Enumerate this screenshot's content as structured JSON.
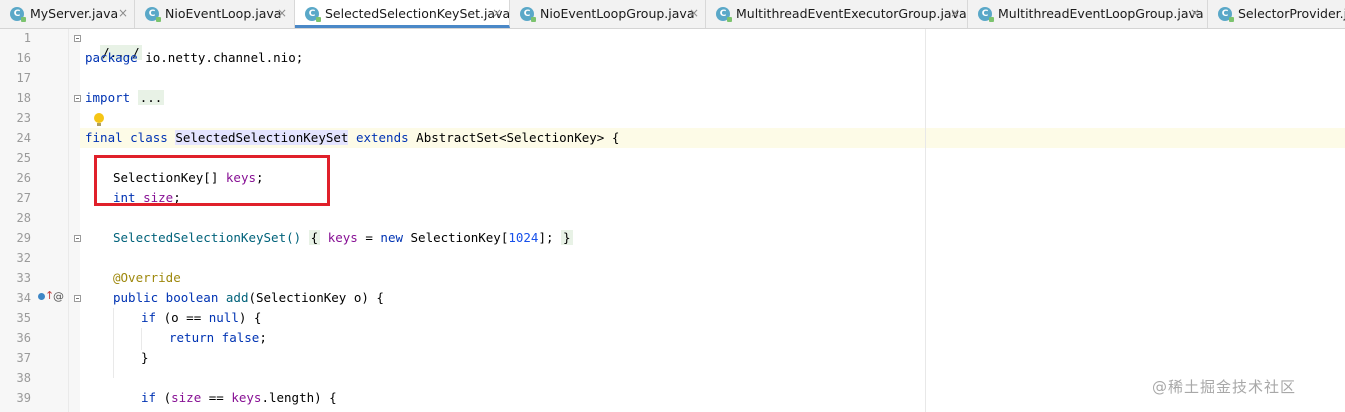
{
  "tabs": [
    {
      "label": "MyServer.java",
      "icon": "C",
      "active": false
    },
    {
      "label": "NioEventLoop.java",
      "icon": "C",
      "active": false
    },
    {
      "label": "SelectedSelectionKeySet.java",
      "icon": "C",
      "active": true
    },
    {
      "label": "NioEventLoopGroup.java",
      "icon": "C",
      "active": false
    },
    {
      "label": "MultithreadEventExecutorGroup.java",
      "icon": "C",
      "active": false
    },
    {
      "label": "MultithreadEventLoopGroup.java",
      "icon": "C",
      "active": false
    },
    {
      "label": "SelectorProvider.java",
      "icon": "C",
      "active": false
    }
  ],
  "tab_close_glyph": "×",
  "gutter": {
    "line_numbers": [
      "1",
      "16",
      "17",
      "18",
      "23",
      "24",
      "25",
      "26",
      "27",
      "28",
      "29",
      "32",
      "33",
      "34",
      "35",
      "36",
      "37",
      "38",
      "39"
    ]
  },
  "code": {
    "l1": "/.../",
    "l16_kw": "package",
    "l16_rest": " io.netty.channel.nio;",
    "l18_kw": "import",
    "l18_fold": "...",
    "l24_kw1": "final class",
    "l24_name": "SelectedSelectionKeySet",
    "l24_kw2": "extends",
    "l24_rest": " AbstractSet<SelectionKey> {",
    "l26_type": "SelectionKey[] ",
    "l26_field": "keys",
    "l26_end": ";",
    "l27_kw": "int",
    "l27_field": "size",
    "l27_end": ";",
    "l29_ctor": "SelectedSelectionKeySet() ",
    "l29_open": "{",
    "l29_field": "keys",
    "l29_eq": " = ",
    "l29_new": "new",
    "l29_type": " SelectionKey[",
    "l29_num": "1024",
    "l29_end": "]; ",
    "l29_close": "}",
    "l33_ann": "@Override",
    "l34_kw": "public boolean",
    "l34_method": "add",
    "l34_rest": "(SelectionKey o) {",
    "l35_kw": "if",
    "l35_rest": " (o == ",
    "l35_null": "null",
    "l35_end": ") {",
    "l36_kw": "return false",
    "l36_end": ";",
    "l37": "}",
    "l39_kw": "if",
    "l39_open": " (",
    "l39_f1": "size",
    "l39_mid": " == ",
    "l39_f2": "keys",
    "l39_rest": ".length) {"
  },
  "gutter_icons": {
    "override": "↑",
    "annotation": "@"
  },
  "watermark": "@稀土掘金技术社区",
  "colors": {
    "keyword": "#0033b3",
    "field": "#871094",
    "annotation": "#9e880d",
    "number": "#1750eb",
    "highlight_box": "#e0202a",
    "active_tab_underline": "#4a88c7"
  }
}
